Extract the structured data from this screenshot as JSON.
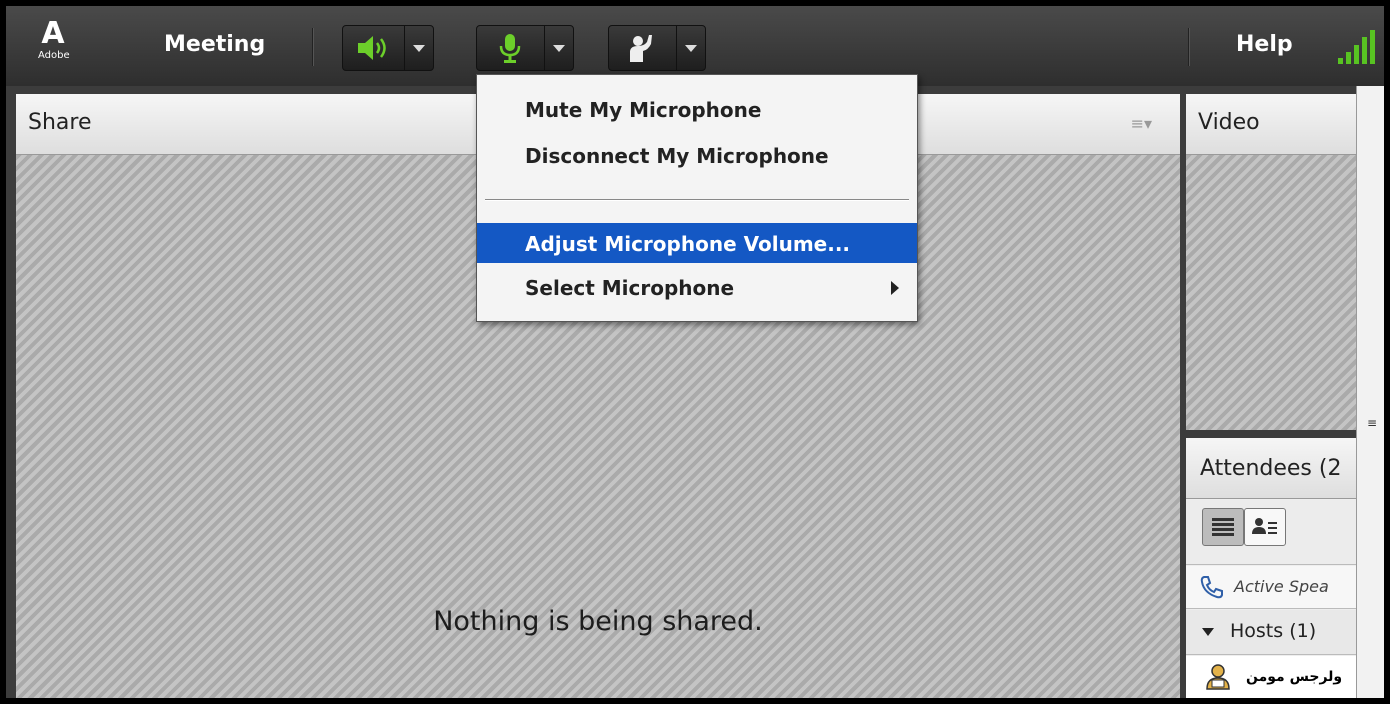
{
  "topbar": {
    "logo_text": "Adobe",
    "meeting_label": "Meeting",
    "help_label": "Help",
    "speaker_icon": "speaker-icon",
    "mic_icon": "microphone-icon",
    "raise_hand_icon": "raise-hand-icon",
    "signal_icon": "connection-signal-icon"
  },
  "share_pod": {
    "title": "Share",
    "empty_message": "Nothing is being shared."
  },
  "video_pod": {
    "title": "Video"
  },
  "mic_menu": {
    "items": [
      {
        "label": "Mute My Microphone"
      },
      {
        "label": "Disconnect My Microphone"
      },
      {
        "label": "Adjust Microphone Volume...",
        "highlighted": true
      },
      {
        "label": "Select Microphone",
        "submenu": true
      }
    ]
  },
  "attendees_pod": {
    "title": "Attendees",
    "count_visible": "(2",
    "active_speakers_label": "Active Spea",
    "hosts_label": "Hosts (1)",
    "host_name": "ولرجس مومن"
  },
  "colors": {
    "accent_green": "#6ccf2a",
    "menu_highlight": "#1458c4",
    "topbar": "#3a3a3a"
  }
}
